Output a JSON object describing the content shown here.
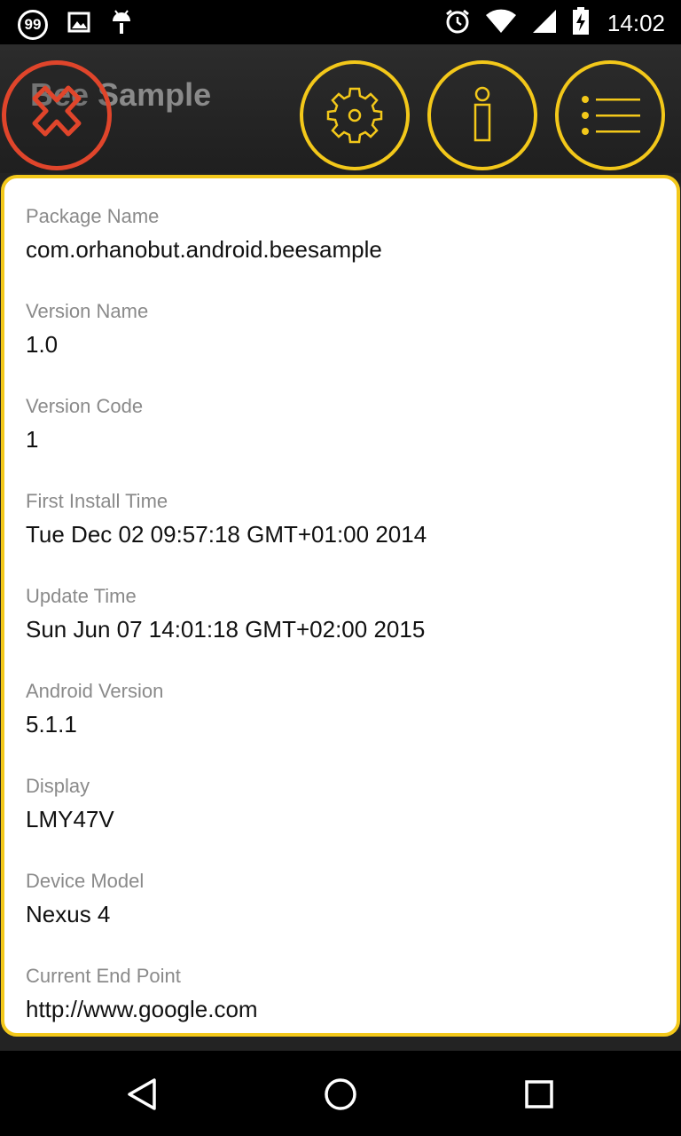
{
  "status_bar": {
    "notification_count": "99",
    "time": "14:02",
    "icons": [
      "notification-count-icon",
      "image-icon",
      "android-debug-icon",
      "alarm-icon",
      "wifi-icon",
      "cell-signal-icon",
      "battery-charging-icon"
    ]
  },
  "toolbar": {
    "title": "Bee Sample",
    "buttons": [
      "close-icon",
      "gear-icon",
      "info-icon",
      "list-icon"
    ],
    "colors": {
      "accent": "#f3c81a",
      "close": "#e0452b"
    }
  },
  "info": {
    "items": [
      {
        "label": "Package Name",
        "value": "com.orhanobut.android.beesample"
      },
      {
        "label": "Version Name",
        "value": "1.0"
      },
      {
        "label": "Version Code",
        "value": "1"
      },
      {
        "label": "First Install Time",
        "value": "Tue Dec 02 09:57:18 GMT+01:00 2014"
      },
      {
        "label": "Update Time",
        "value": "Sun Jun 07 14:01:18 GMT+02:00 2015"
      },
      {
        "label": "Android Version",
        "value": "5.1.1"
      },
      {
        "label": "Display",
        "value": "LMY47V"
      },
      {
        "label": "Device Model",
        "value": "Nexus 4"
      },
      {
        "label": "Current End Point",
        "value": "http://www.google.com"
      }
    ]
  },
  "nav_bar": {
    "icons": [
      "back-icon",
      "home-icon",
      "recent-apps-icon"
    ]
  }
}
